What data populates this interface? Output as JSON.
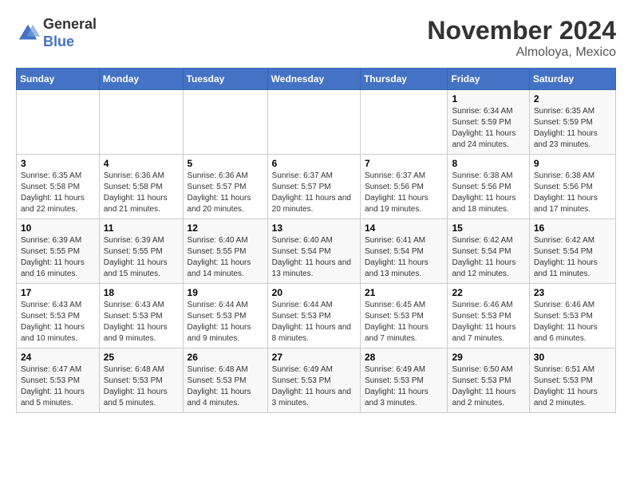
{
  "logo": {
    "line1": "General",
    "line2": "Blue"
  },
  "title": "November 2024",
  "subtitle": "Almoloya, Mexico",
  "days_of_week": [
    "Sunday",
    "Monday",
    "Tuesday",
    "Wednesday",
    "Thursday",
    "Friday",
    "Saturday"
  ],
  "weeks": [
    [
      {
        "day": "",
        "info": ""
      },
      {
        "day": "",
        "info": ""
      },
      {
        "day": "",
        "info": ""
      },
      {
        "day": "",
        "info": ""
      },
      {
        "day": "",
        "info": ""
      },
      {
        "day": "1",
        "info": "Sunrise: 6:34 AM\nSunset: 5:59 PM\nDaylight: 11 hours and 24 minutes."
      },
      {
        "day": "2",
        "info": "Sunrise: 6:35 AM\nSunset: 5:59 PM\nDaylight: 11 hours and 23 minutes."
      }
    ],
    [
      {
        "day": "3",
        "info": "Sunrise: 6:35 AM\nSunset: 5:58 PM\nDaylight: 11 hours and 22 minutes."
      },
      {
        "day": "4",
        "info": "Sunrise: 6:36 AM\nSunset: 5:58 PM\nDaylight: 11 hours and 21 minutes."
      },
      {
        "day": "5",
        "info": "Sunrise: 6:36 AM\nSunset: 5:57 PM\nDaylight: 11 hours and 20 minutes."
      },
      {
        "day": "6",
        "info": "Sunrise: 6:37 AM\nSunset: 5:57 PM\nDaylight: 11 hours and 20 minutes."
      },
      {
        "day": "7",
        "info": "Sunrise: 6:37 AM\nSunset: 5:56 PM\nDaylight: 11 hours and 19 minutes."
      },
      {
        "day": "8",
        "info": "Sunrise: 6:38 AM\nSunset: 5:56 PM\nDaylight: 11 hours and 18 minutes."
      },
      {
        "day": "9",
        "info": "Sunrise: 6:38 AM\nSunset: 5:56 PM\nDaylight: 11 hours and 17 minutes."
      }
    ],
    [
      {
        "day": "10",
        "info": "Sunrise: 6:39 AM\nSunset: 5:55 PM\nDaylight: 11 hours and 16 minutes."
      },
      {
        "day": "11",
        "info": "Sunrise: 6:39 AM\nSunset: 5:55 PM\nDaylight: 11 hours and 15 minutes."
      },
      {
        "day": "12",
        "info": "Sunrise: 6:40 AM\nSunset: 5:55 PM\nDaylight: 11 hours and 14 minutes."
      },
      {
        "day": "13",
        "info": "Sunrise: 6:40 AM\nSunset: 5:54 PM\nDaylight: 11 hours and 13 minutes."
      },
      {
        "day": "14",
        "info": "Sunrise: 6:41 AM\nSunset: 5:54 PM\nDaylight: 11 hours and 13 minutes."
      },
      {
        "day": "15",
        "info": "Sunrise: 6:42 AM\nSunset: 5:54 PM\nDaylight: 11 hours and 12 minutes."
      },
      {
        "day": "16",
        "info": "Sunrise: 6:42 AM\nSunset: 5:54 PM\nDaylight: 11 hours and 11 minutes."
      }
    ],
    [
      {
        "day": "17",
        "info": "Sunrise: 6:43 AM\nSunset: 5:53 PM\nDaylight: 11 hours and 10 minutes."
      },
      {
        "day": "18",
        "info": "Sunrise: 6:43 AM\nSunset: 5:53 PM\nDaylight: 11 hours and 9 minutes."
      },
      {
        "day": "19",
        "info": "Sunrise: 6:44 AM\nSunset: 5:53 PM\nDaylight: 11 hours and 9 minutes."
      },
      {
        "day": "20",
        "info": "Sunrise: 6:44 AM\nSunset: 5:53 PM\nDaylight: 11 hours and 8 minutes."
      },
      {
        "day": "21",
        "info": "Sunrise: 6:45 AM\nSunset: 5:53 PM\nDaylight: 11 hours and 7 minutes."
      },
      {
        "day": "22",
        "info": "Sunrise: 6:46 AM\nSunset: 5:53 PM\nDaylight: 11 hours and 7 minutes."
      },
      {
        "day": "23",
        "info": "Sunrise: 6:46 AM\nSunset: 5:53 PM\nDaylight: 11 hours and 6 minutes."
      }
    ],
    [
      {
        "day": "24",
        "info": "Sunrise: 6:47 AM\nSunset: 5:53 PM\nDaylight: 11 hours and 5 minutes."
      },
      {
        "day": "25",
        "info": "Sunrise: 6:48 AM\nSunset: 5:53 PM\nDaylight: 11 hours and 5 minutes."
      },
      {
        "day": "26",
        "info": "Sunrise: 6:48 AM\nSunset: 5:53 PM\nDaylight: 11 hours and 4 minutes."
      },
      {
        "day": "27",
        "info": "Sunrise: 6:49 AM\nSunset: 5:53 PM\nDaylight: 11 hours and 3 minutes."
      },
      {
        "day": "28",
        "info": "Sunrise: 6:49 AM\nSunset: 5:53 PM\nDaylight: 11 hours and 3 minutes."
      },
      {
        "day": "29",
        "info": "Sunrise: 6:50 AM\nSunset: 5:53 PM\nDaylight: 11 hours and 2 minutes."
      },
      {
        "day": "30",
        "info": "Sunrise: 6:51 AM\nSunset: 5:53 PM\nDaylight: 11 hours and 2 minutes."
      }
    ]
  ]
}
